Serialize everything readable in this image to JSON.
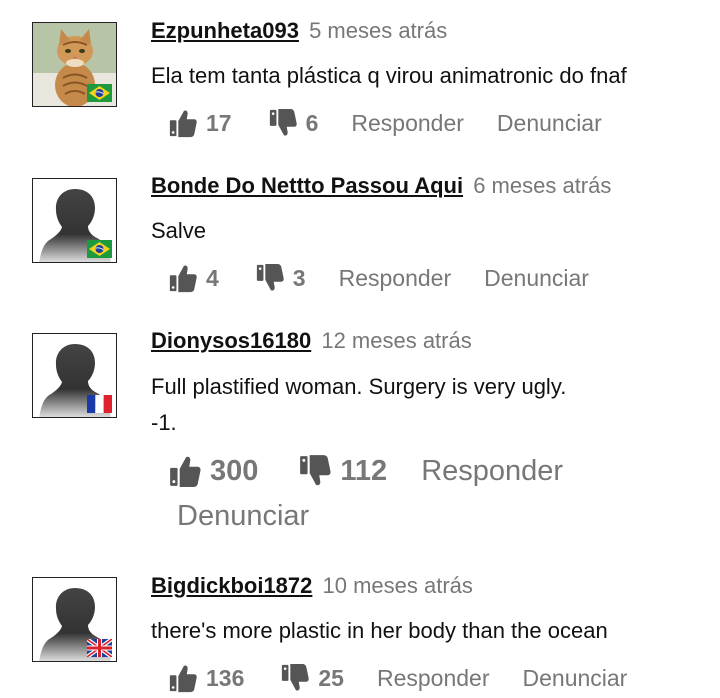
{
  "comments": [
    {
      "username": "Ezpunheta093",
      "time": "5 meses atrás",
      "text": [
        "Ela tem tanta plástica q virou animatronic do fnaf"
      ],
      "likes": "17",
      "dislikes": "6",
      "reply_label": "Responder",
      "report_label": "Denunciar",
      "avatar": "cat-photo",
      "flag": "brazil-flag"
    },
    {
      "username": "Bonde Do Nettto Passou Aqui",
      "time": "6 meses atrás",
      "text": [
        "Salve"
      ],
      "likes": "4",
      "dislikes": "3",
      "reply_label": "Responder",
      "report_label": "Denunciar",
      "avatar": "default-silhouette",
      "flag": "brazil-flag"
    },
    {
      "username": "Dionysos16180",
      "time": "12 meses atrás",
      "text": [
        "Full plastified woman. Surgery is very ugly.",
        "-1."
      ],
      "likes": "300",
      "dislikes": "112",
      "reply_label": "Responder",
      "report_label": "Denunciar",
      "avatar": "default-silhouette",
      "flag": "france-flag"
    },
    {
      "username": "Bigdickboi1872",
      "time": "10 meses atrás",
      "text": [
        "there's more plastic in her body than the ocean"
      ],
      "likes": "136",
      "dislikes": "25",
      "reply_label": "Responder",
      "report_label": "Denunciar",
      "avatar": "default-silhouette",
      "flag": "uk-flag"
    }
  ],
  "colors": {
    "text": "#111111",
    "muted": "#777777",
    "icon": "#555555"
  }
}
